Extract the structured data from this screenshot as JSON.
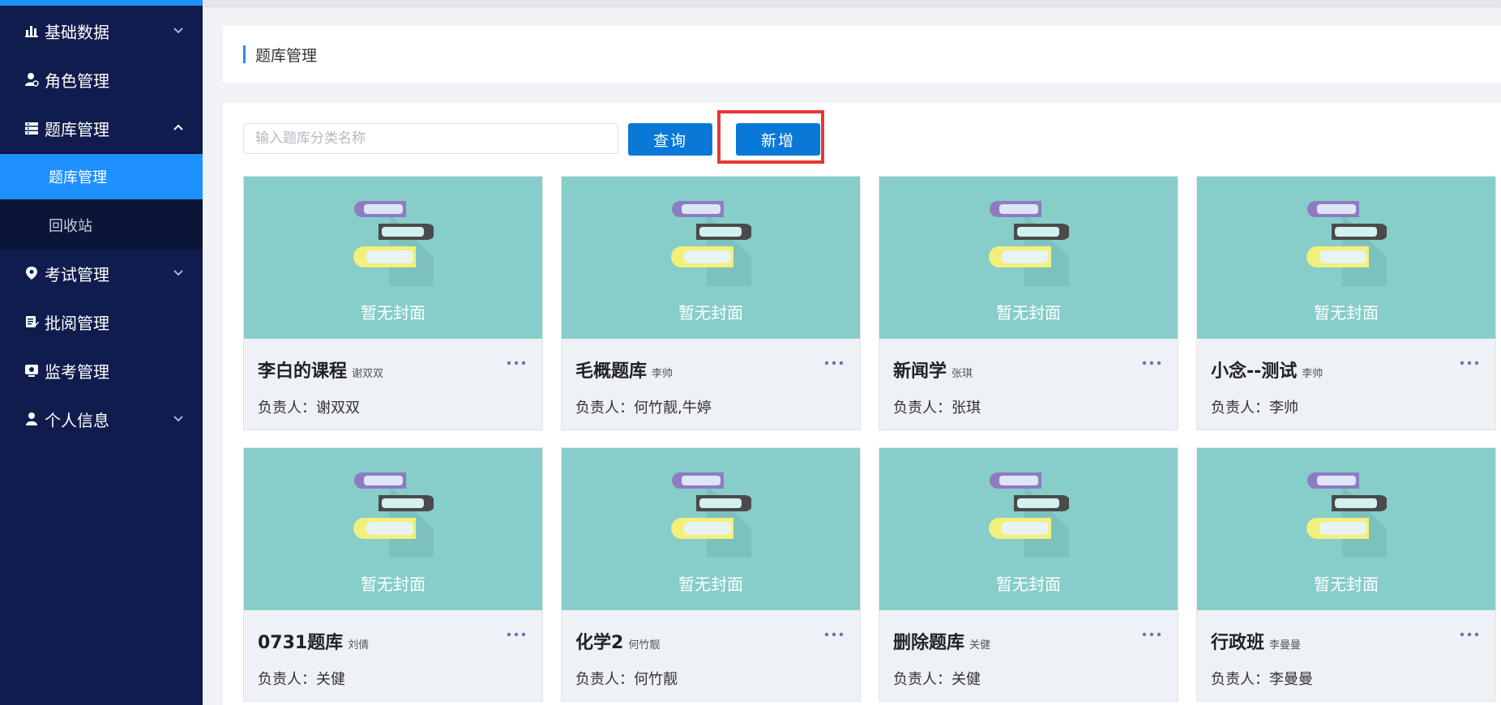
{
  "sidebar": {
    "items": [
      {
        "label": "基础数据",
        "icon": "bar-chart-icon",
        "has_chevron": true,
        "expanded": false
      },
      {
        "label": "角色管理",
        "icon": "user-gear-icon",
        "has_chevron": false
      },
      {
        "label": "题库管理",
        "icon": "list-icon",
        "has_chevron": true,
        "expanded": true
      },
      {
        "label": "考试管理",
        "icon": "location-pin-icon",
        "has_chevron": true,
        "expanded": false
      },
      {
        "label": "批阅管理",
        "icon": "edit-note-icon",
        "has_chevron": false
      },
      {
        "label": "监考管理",
        "icon": "monitor-icon",
        "has_chevron": false
      },
      {
        "label": "个人信息",
        "icon": "person-icon",
        "has_chevron": true,
        "expanded": false
      }
    ],
    "subitems": [
      {
        "label": "题库管理",
        "active": true
      },
      {
        "label": "回收站",
        "active": false
      }
    ]
  },
  "page": {
    "title": "题库管理"
  },
  "toolbar": {
    "search_placeholder": "输入题库分类名称",
    "query_label": "查询",
    "add_label": "新增"
  },
  "colors": {
    "sidebar_bg": "#0f1c4d",
    "accent": "#1e90ff",
    "button": "#0a78d6",
    "cover_bg": "#87cdc9",
    "highlight": "#e53935"
  },
  "cards": [
    {
      "name": "李白的课程",
      "owner": "谢双双",
      "cover_text": "暂无封面",
      "charge_label": "负责人：",
      "charge": "谢双双"
    },
    {
      "name": "毛概题库",
      "owner": "李帅",
      "cover_text": "暂无封面",
      "charge_label": "负责人：",
      "charge": "何竹靓,牛婷"
    },
    {
      "name": "新闻学",
      "owner": "张琪",
      "cover_text": "暂无封面",
      "charge_label": "负责人：",
      "charge": "张琪"
    },
    {
      "name": "小念--测试",
      "owner": "李帅",
      "cover_text": "暂无封面",
      "charge_label": "负责人：",
      "charge": "李帅"
    },
    {
      "name": "0731题库",
      "owner": "刘倩",
      "cover_text": "暂无封面",
      "charge_label": "负责人：",
      "charge": "关健"
    },
    {
      "name": "化学2",
      "owner": "何竹靓",
      "cover_text": "暂无封面",
      "charge_label": "负责人：",
      "charge": "何竹靓"
    },
    {
      "name": "删除题库",
      "owner": "关健",
      "cover_text": "暂无封面",
      "charge_label": "负责人：",
      "charge": "关健"
    },
    {
      "name": "行政班",
      "owner": "李曼曼",
      "cover_text": "暂无封面",
      "charge_label": "负责人：",
      "charge": "李曼曼"
    }
  ]
}
